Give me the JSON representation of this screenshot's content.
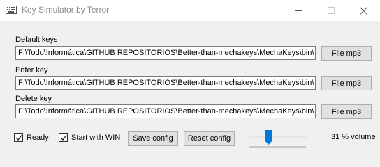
{
  "window": {
    "title": "Key Simulator by Terror",
    "icon": "keyboard-icon"
  },
  "groups": [
    {
      "label": "Default keys",
      "path": "F:\\Todo\\Informática\\GITHUB REPOSITORIOS\\Better-than-mechakeys\\MechaKeys\\bin\\",
      "button": "File mp3"
    },
    {
      "label": "Enter key",
      "path": "F:\\Todo\\Informática\\GITHUB REPOSITORIOS\\Better-than-mechakeys\\MechaKeys\\bin\\",
      "button": "File mp3"
    },
    {
      "label": "Delete key",
      "path": "F:\\Todo\\Informática\\GITHUB REPOSITORIOS\\Better-than-mechakeys\\MechaKeys\\bin\\",
      "button": "File mp3"
    }
  ],
  "bottom": {
    "ready": {
      "label": "Ready",
      "checked": true
    },
    "start_with_win": {
      "label": "Start with WIN",
      "checked": true
    },
    "save_config": "Save config",
    "reset_config": "Reset config",
    "volume_percent": 31,
    "volume_label": "31 % volume"
  },
  "colors": {
    "slider_thumb": "#0078d7",
    "title_text": "#8a8a8a"
  }
}
